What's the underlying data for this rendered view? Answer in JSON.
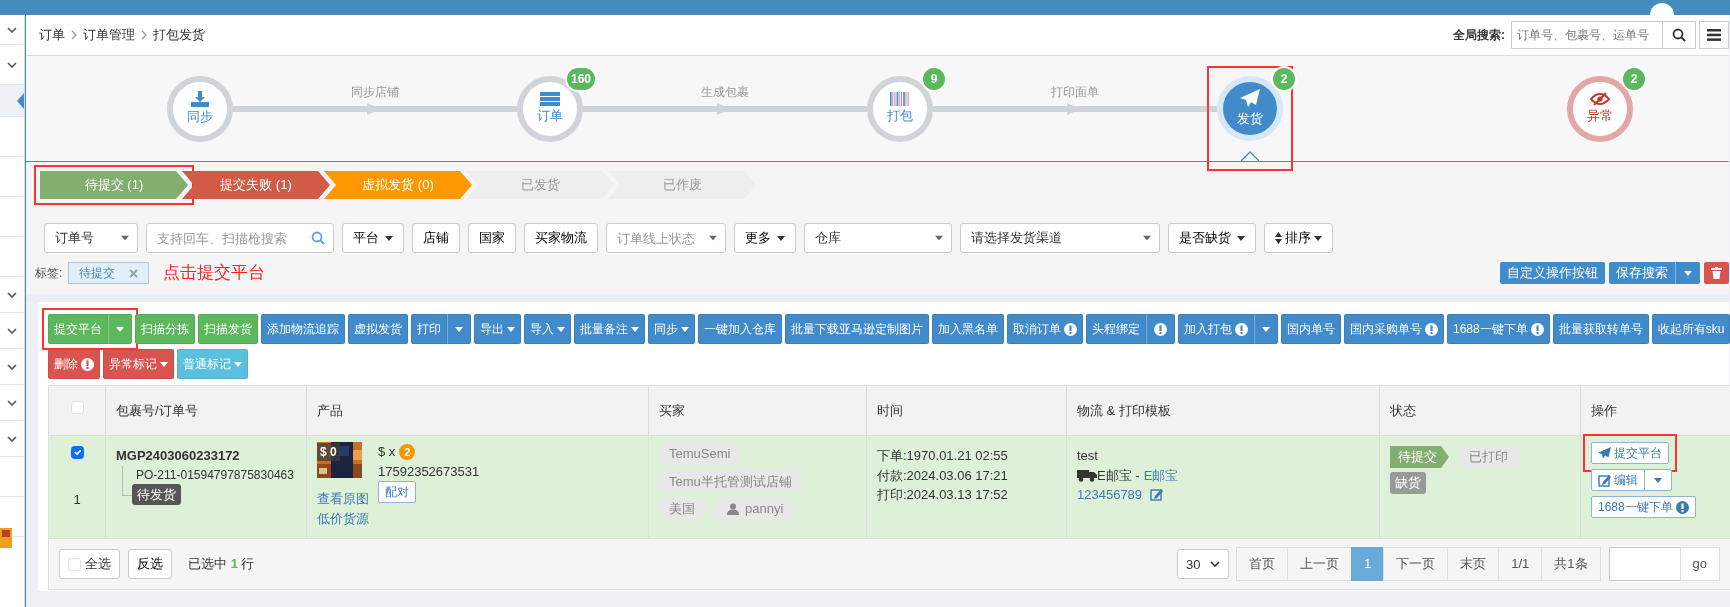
{
  "breadcrumb": [
    "订单",
    "订单管理",
    "打包发货"
  ],
  "global_search": {
    "label": "全局搜索:",
    "placeholder": "订单号、包裹号、运单号"
  },
  "workflow": [
    {
      "kind": "sync",
      "label": "同步",
      "selected": false,
      "link_label": "同步店铺"
    },
    {
      "kind": "order",
      "label": "订单",
      "badge": "160",
      "selected": false,
      "link_label": "生成包裹"
    },
    {
      "kind": "pack",
      "label": "打包",
      "badge": "9",
      "selected": false,
      "link_label": "打印面单"
    },
    {
      "kind": "ship",
      "label": "发货",
      "badge": "2",
      "selected": true,
      "highlighted": true
    },
    {
      "kind": "exception",
      "label": "异常",
      "badge": "2",
      "selected": false
    }
  ],
  "status_tabs": [
    {
      "label": "待提交 (1)",
      "color": "#82af6f",
      "highlighted": true
    },
    {
      "label": "提交失败 (1)",
      "color": "#d15b47"
    },
    {
      "label": "虚拟发货 (0)",
      "color": "#ff9800"
    },
    {
      "label": "已发货",
      "color": "#eeeeee"
    },
    {
      "label": "已作废",
      "color": "#eeeeee"
    }
  ],
  "filters": [
    {
      "kind": "select",
      "value": "订单号"
    },
    {
      "kind": "search",
      "placeholder": "支持回车、扫描枪搜索"
    },
    {
      "kind": "dropdown",
      "label": "平台"
    },
    {
      "kind": "button",
      "label": "店铺"
    },
    {
      "kind": "button",
      "label": "国家"
    },
    {
      "kind": "button",
      "label": "买家物流"
    },
    {
      "kind": "select",
      "placeholder": "订单线上状态"
    },
    {
      "kind": "dropdown",
      "label": "更多"
    },
    {
      "kind": "select",
      "value": "仓库"
    },
    {
      "kind": "select",
      "value": "请选择发货渠道"
    },
    {
      "kind": "dropdown",
      "label": "是否缺货"
    },
    {
      "kind": "sort",
      "label": "排序"
    }
  ],
  "tags": {
    "label": "标签:",
    "items": [
      {
        "label": "待提交"
      }
    ]
  },
  "annotation": "点击提交平台",
  "header_buttons": [
    {
      "kind": "text",
      "label": "自定义操作按钮",
      "color": "#428bca"
    },
    {
      "kind": "text",
      "label": "保存搜索",
      "color": "#428bca",
      "split_caret": true
    },
    {
      "kind": "trash",
      "color": "#d9534f"
    }
  ],
  "toolbar": [
    [
      {
        "label": "提交平台",
        "color": "#5cb85c",
        "split_caret": true,
        "highlighted": true
      },
      {
        "label": "扫描分拣",
        "color": "#5cb85c"
      },
      {
        "label": "扫描发货",
        "color": "#5cb85c"
      },
      {
        "label": "添加物流追踪",
        "color": "#428bca"
      },
      {
        "label": "虚拟发货",
        "color": "#428bca"
      },
      {
        "label": "打印",
        "color": "#428bca",
        "split_caret": true
      },
      {
        "label": "导出",
        "color": "#428bca",
        "caret": true
      },
      {
        "label": "导入",
        "color": "#428bca",
        "caret": true
      },
      {
        "label": "批量备注",
        "color": "#428bca",
        "caret": true
      },
      {
        "label": "同步",
        "color": "#428bca",
        "caret": true
      },
      {
        "label": "一键加入仓库",
        "color": "#428bca"
      },
      {
        "label": "批量下载亚马逊定制图片",
        "color": "#428bca"
      },
      {
        "label": "加入黑名单",
        "color": "#428bca"
      },
      {
        "label": "取消订单",
        "color": "#428bca",
        "alert": true
      },
      {
        "label": "头程绑定",
        "color": "#428bca",
        "split_alert": true
      },
      {
        "label": "加入打包",
        "color": "#428bca",
        "alert": true,
        "split_caret": true
      },
      {
        "label": "国内单号",
        "color": "#428bca"
      },
      {
        "label": "国内采购单号",
        "color": "#428bca",
        "alert": true
      },
      {
        "label": "1688一键下单",
        "color": "#428bca",
        "alert": true
      },
      {
        "label": "批量获取转单号",
        "color": "#428bca"
      },
      {
        "label": "收起所有sku",
        "color": "#428bca"
      }
    ],
    [
      {
        "label": "删除",
        "color": "#d9534f",
        "alert": true
      },
      {
        "label": "异常标记",
        "color": "#d9534f",
        "caret": true
      },
      {
        "label": "普通标记",
        "color": "#5bc0de",
        "caret": true
      }
    ]
  ],
  "table": {
    "select_all_checked": false,
    "columns": [
      "包裹号/订单号",
      "产品",
      "买家",
      "时间",
      "物流 & 打印模板",
      "状态",
      "操作"
    ],
    "rows": [
      {
        "selected": true,
        "index": "1",
        "package_no": "MGP2403060233172",
        "order_no": "PO-211-01594797875830463",
        "package_status": "待发货",
        "product": {
          "kind": "picture",
          "picture_price": "$ 0",
          "price": "$ x",
          "quantity": "2",
          "sku": "17592352673531",
          "pair_button": "配对",
          "links": [
            "查看原图",
            "低价货源"
          ]
        },
        "buyer": {
          "tags": [
            "TemuSemi",
            "Temu半托管测试店铺",
            "美国"
          ],
          "user": "pannyi"
        },
        "times": [
          "下单:1970.01.21 02:55",
          "付款:2024.03.06 17:21",
          "打印:2024.03.13 17:52"
        ],
        "logistics": {
          "template": "test",
          "carrier": "E邮宝 - ",
          "carrier_link": "E邮宝",
          "tracking_no": "123456789"
        },
        "status": {
          "steps": [
            {
              "label": "待提交",
              "done": true
            },
            {
              "label": "已打印",
              "done": false
            }
          ],
          "badges": [
            "缺货"
          ]
        },
        "actions": [
          {
            "kind": "submit",
            "label": "提交平台",
            "highlighted": true
          },
          {
            "kind": "edit",
            "label": "编辑"
          },
          {
            "kind": "order",
            "label": "1688一键下单"
          }
        ]
      }
    ]
  },
  "footer": {
    "select_all": {
      "label": "全选",
      "checked": false
    },
    "invert": "反选",
    "summary": "已选中 **1** 行"
  },
  "pagination": {
    "page_size": "30",
    "pages": [
      {
        "label": "首页",
        "selected": false
      },
      {
        "label": "上一页",
        "selected": false
      },
      {
        "label": "1",
        "selected": true
      },
      {
        "label": "下一页",
        "selected": false
      },
      {
        "label": "末页",
        "selected": false
      },
      {
        "label": "1/1",
        "selected": false
      },
      {
        "label": "共1条",
        "selected": false
      }
    ],
    "go": "go"
  }
}
